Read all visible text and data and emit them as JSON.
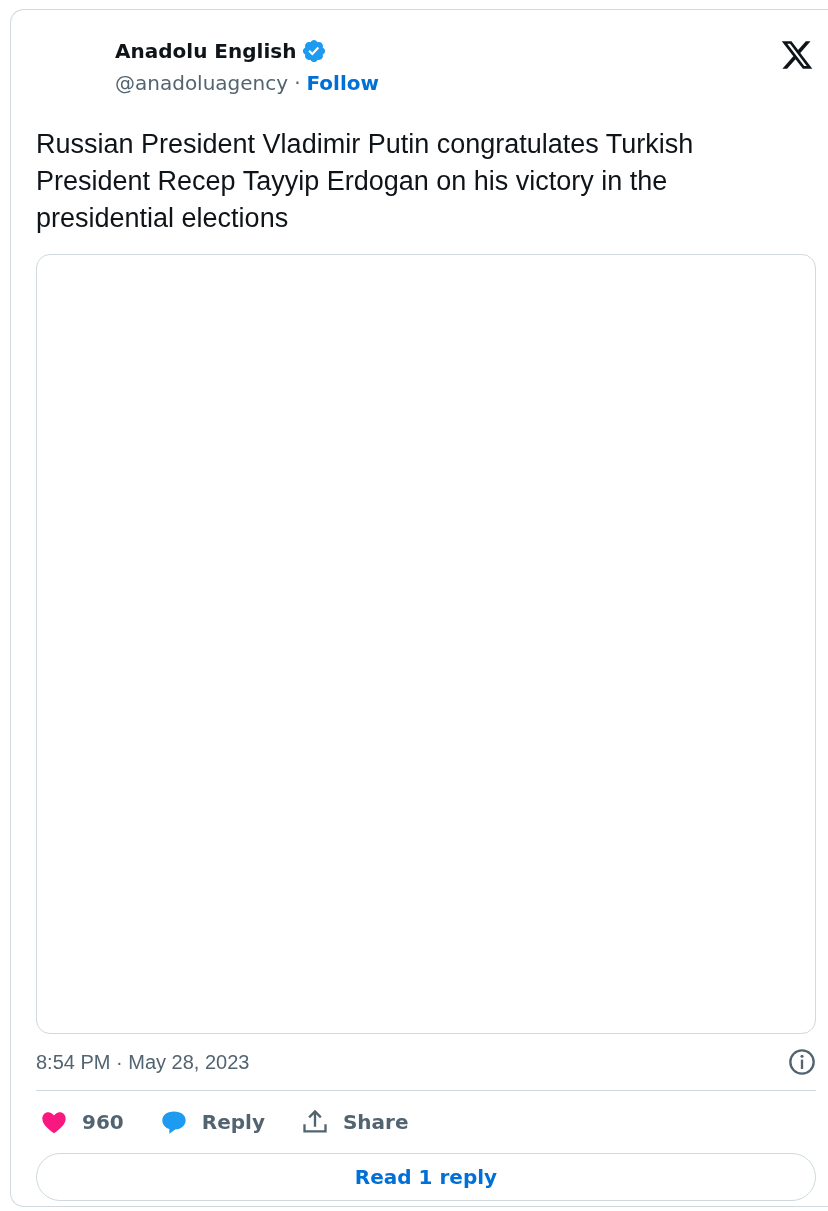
{
  "author": {
    "name": "Anadolu English",
    "verified": true,
    "handle": "@anadoluagency",
    "separator": "·",
    "follow": "Follow"
  },
  "text": "Russian President Vladimir Putin congratulates Turkish President Recep Tayyip Erdogan on his victory in the presidential elections",
  "timestamp": "8:54 PM · May 28, 2023",
  "actions": [
    {
      "kind": "like",
      "label": "960"
    },
    {
      "kind": "reply",
      "label": "Reply"
    },
    {
      "kind": "share",
      "label": "Share"
    }
  ],
  "read_replies": "Read 1 reply"
}
